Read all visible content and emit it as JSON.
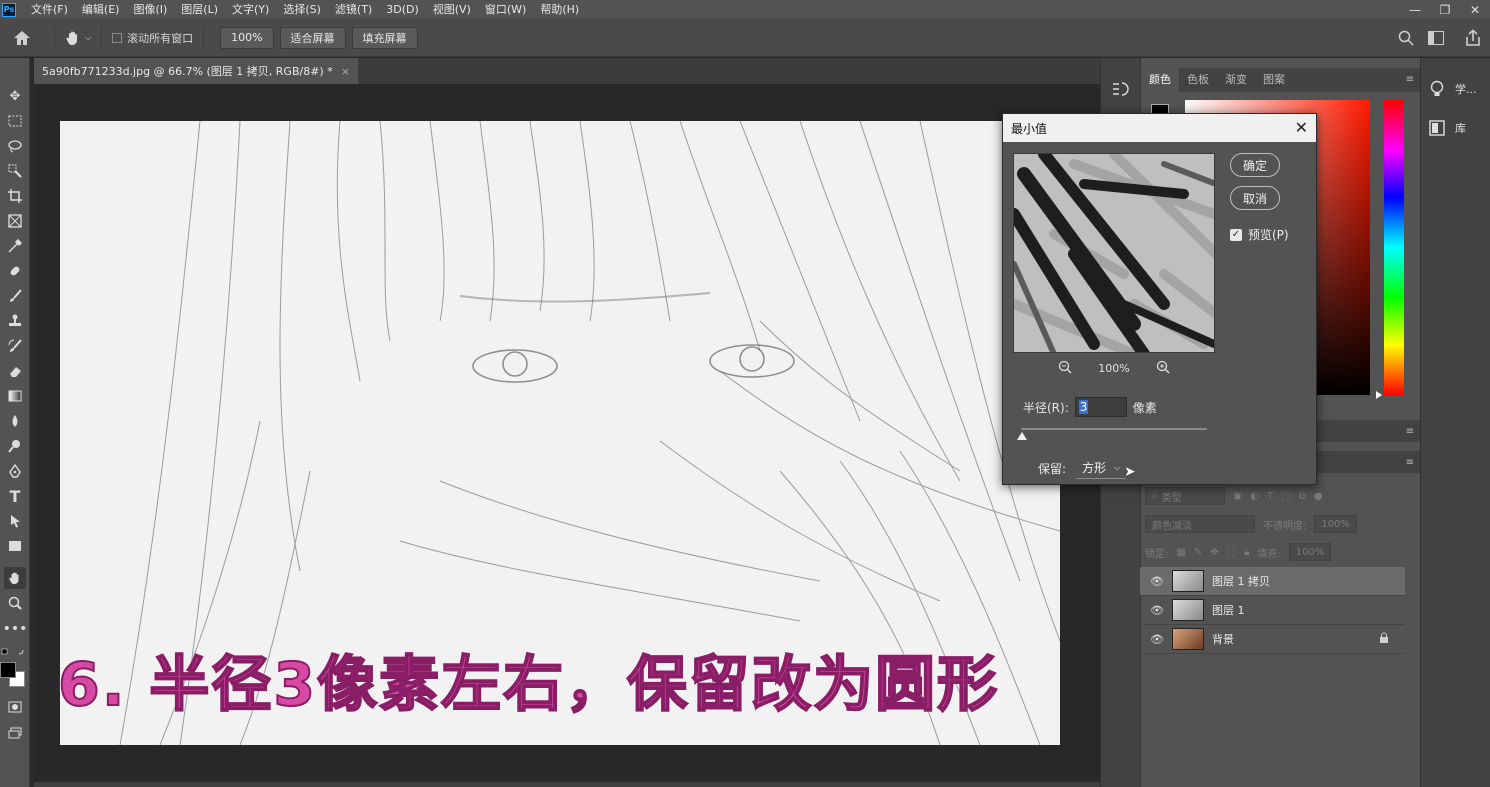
{
  "menubar": {
    "logo": "Ps",
    "items": [
      "文件(F)",
      "编辑(E)",
      "图像(I)",
      "图层(L)",
      "文字(Y)",
      "选择(S)",
      "滤镜(T)",
      "3D(D)",
      "视图(V)",
      "窗口(W)",
      "帮助(H)"
    ],
    "minimize": "—",
    "restore": "❐",
    "close": "✕"
  },
  "options": {
    "scroll_all_label": "滚动所有窗口",
    "zoom_value": "100%",
    "fit_screen": "适合屏幕",
    "fill_screen": "填充屏幕"
  },
  "document": {
    "tab_title": "5a90fb771233d.jpg @ 66.7% (图层 1 拷贝, RGB/8#) *",
    "tab_close": "×"
  },
  "caption": "6. 半径3像素左右，保留改为圆形",
  "color_panel": {
    "tabs": [
      "颜色",
      "色板",
      "渐变",
      "图案"
    ],
    "active_tab": "颜色"
  },
  "far_dock": {
    "learn": "学...",
    "library": "库"
  },
  "layers_panel": {
    "search_placeholder": "类型",
    "blend_mode": "颜色减淡",
    "opacity_label": "不透明度:",
    "opacity_value": "100%",
    "lock_label": "锁定:",
    "fill_label": "填充:",
    "fill_value": "100%",
    "layers": [
      {
        "name": "图层 1 拷贝"
      },
      {
        "name": "图层 1"
      },
      {
        "name": "背景"
      }
    ]
  },
  "dialog": {
    "title": "最小值",
    "ok": "确定",
    "cancel": "取消",
    "preview_label": "预览(P)",
    "zoom_value": "100%",
    "radius_label": "半径(R):",
    "radius_value": "3",
    "radius_unit": "像素",
    "preserve_label": "保留:",
    "preserve_value": "方形"
  }
}
